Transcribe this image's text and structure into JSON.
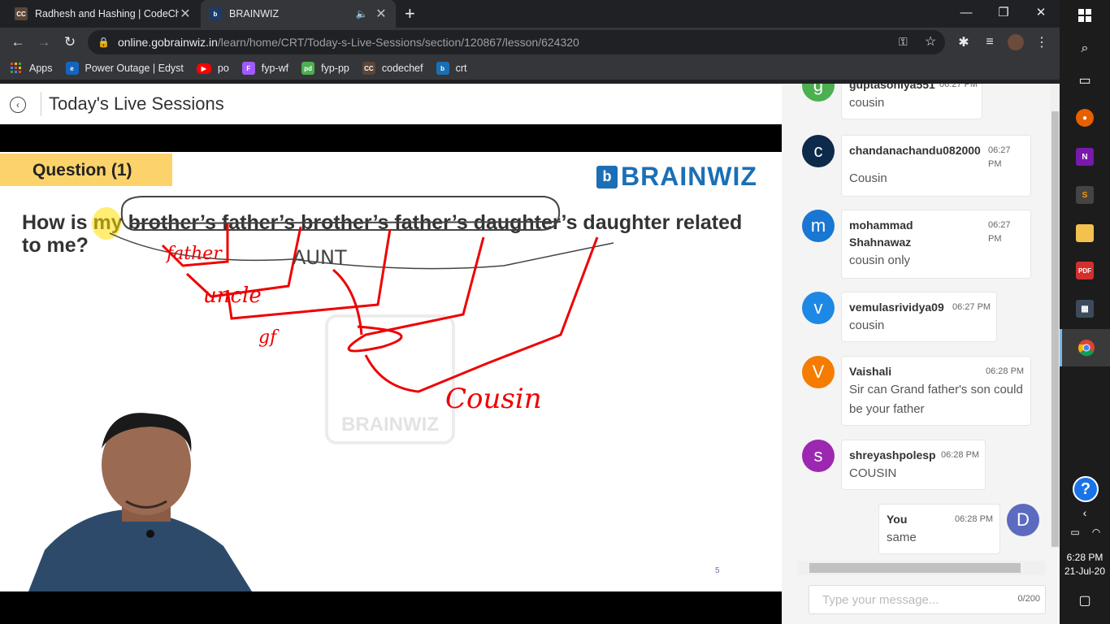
{
  "browser": {
    "tabs": [
      {
        "title": "Radhesh and Hashing | CodeChef",
        "favicon": "CC"
      },
      {
        "title": "BRAINWIZ",
        "favicon": "b"
      }
    ],
    "url_host": "online.gobrainwiz.in",
    "url_path": "/learn/home/CRT/Today-s-Live-Sessions/section/120867/lesson/624320",
    "bookmarks": [
      {
        "label": "Apps",
        "icon": "apps-grid-icon",
        "color": "#4285f4"
      },
      {
        "label": "Power Outage | Edyst",
        "icon": "edyst-icon",
        "color": "#1565c0"
      },
      {
        "label": "po",
        "icon": "youtube-icon",
        "color": "#ff0000"
      },
      {
        "label": "fyp-wf",
        "icon": "figma-icon",
        "color": "#a259ff"
      },
      {
        "label": "fyp-pp",
        "icon": "pd-icon",
        "color": "#4caf50"
      },
      {
        "label": "codechef",
        "icon": "codechef-icon",
        "color": "#5b4638"
      },
      {
        "label": "crt",
        "icon": "brainwiz-icon",
        "color": "#1b6fb5"
      }
    ]
  },
  "page": {
    "title": "Today's Live Sessions"
  },
  "slide": {
    "question_tag": "Question (1)",
    "logo": "BRAINWIZ",
    "question": "How is my brother’s father’s brother’s father’s daughter’s daughter related to me?",
    "watermark": "BRAINWIZ",
    "annotations": [
      "father",
      "uncle",
      "AUNT",
      "gf",
      "Cousin"
    ],
    "slide_number": "5"
  },
  "chat": {
    "messages": [
      {
        "avatar": "g",
        "user": "guptasoniya551",
        "time": "06:27 PM",
        "text": "cousin",
        "color": "#4caf50"
      },
      {
        "avatar": "c",
        "user": "chandanachandu082000",
        "time": "06:27 PM",
        "text": "Cousin",
        "color": "#0d2a4a"
      },
      {
        "avatar": "m",
        "user": "mohammad Shahnawaz",
        "time": "06:27 PM",
        "text": "cousin only",
        "color": "#1976d2"
      },
      {
        "avatar": "v",
        "user": "vemulasrividya09",
        "time": "06:27 PM",
        "text": "cousin",
        "color": "#1e88e5"
      },
      {
        "avatar": "V",
        "user": "Vaishali",
        "time": "06:28 PM",
        "text": "Sir can Grand father's son could be your father",
        "color": "#f57c00"
      },
      {
        "avatar": "s",
        "user": "shreyashpolesp",
        "time": "06:28 PM",
        "text": "COUSIN",
        "color": "#9c27b0"
      },
      {
        "avatar": "D",
        "user": "You",
        "time": "06:28 PM",
        "text": "same",
        "color": "#5c6bc0"
      }
    ],
    "input_placeholder": "Type your message...",
    "counter": "0/200"
  },
  "taskbar": {
    "time": "6:28 PM",
    "date": "21-Jul-20"
  }
}
